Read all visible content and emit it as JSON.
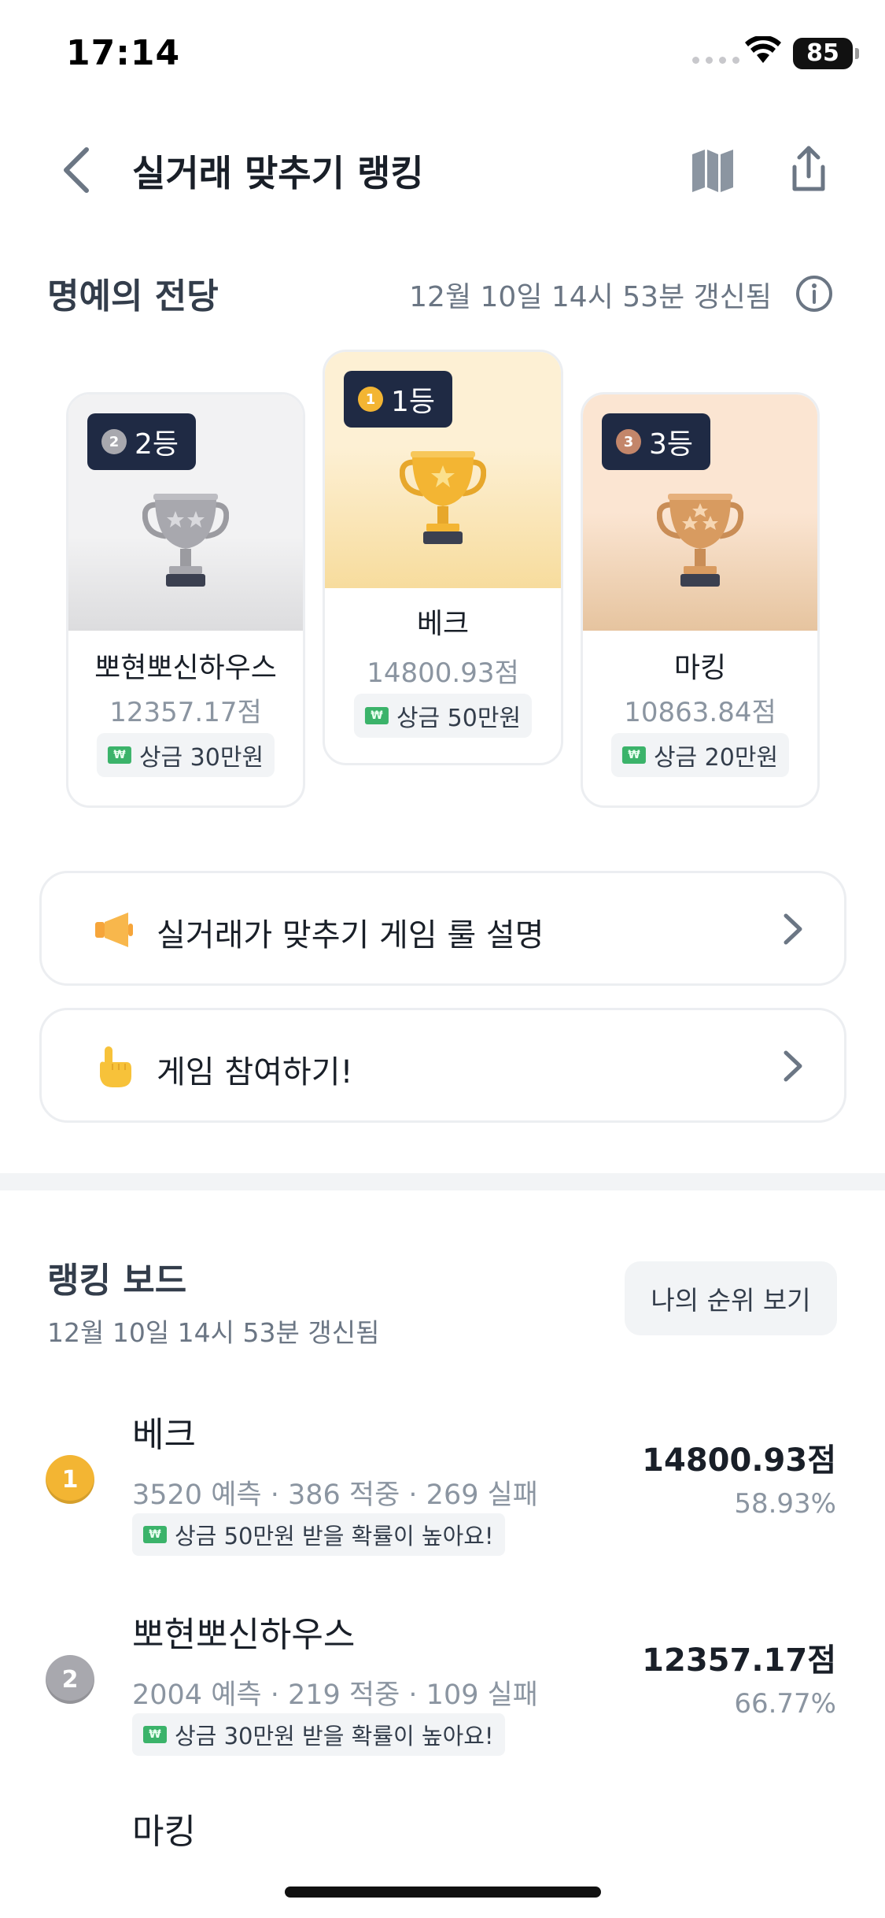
{
  "status_bar": {
    "time": "17:14",
    "battery": "85"
  },
  "nav": {
    "title": "실거래 맞추기 랭킹"
  },
  "hall_of_fame": {
    "title": "명예의 전당",
    "updated": "12월 10일 14시 53분 갱신됨",
    "podium": [
      {
        "rank_label": "2등",
        "medal": "2",
        "name": "뽀현뽀신하우스",
        "score": "12357.17점",
        "prize": "상금 30만원"
      },
      {
        "rank_label": "1등",
        "medal": "1",
        "name": "베크",
        "score": "14800.93점",
        "prize": "상금 50만원"
      },
      {
        "rank_label": "3등",
        "medal": "3",
        "name": "마킹",
        "score": "10863.84점",
        "prize": "상금 20만원"
      }
    ]
  },
  "links": {
    "rules": "실거래가 맞추기 게임 룰 설명",
    "join": "게임 참여하기!"
  },
  "ranking_board": {
    "title": "랭킹 보드",
    "updated": "12월 10일 14시 53분 갱신됨",
    "my_rank_button": "나의 순위 보기",
    "rows": [
      {
        "rank": "1",
        "name": "베크",
        "stats": "3520 예측 · 386 적중 · 269 실패",
        "chip": "상금 50만원 받을 확률이 높아요!",
        "score": "14800.93점",
        "rate": "58.93%"
      },
      {
        "rank": "2",
        "name": "뽀현뽀신하우스",
        "stats": "2004 예측 · 219 적중 · 109 실패",
        "chip": "상금 30만원 받을 확률이 높아요!",
        "score": "12357.17점",
        "rate": "66.77%"
      },
      {
        "name": "마킹"
      }
    ]
  },
  "colors": {
    "gold": "#f3b533",
    "silver": "#a8a8ae",
    "bronze": "#c3866a",
    "navy_badge": "#1f2a44"
  }
}
